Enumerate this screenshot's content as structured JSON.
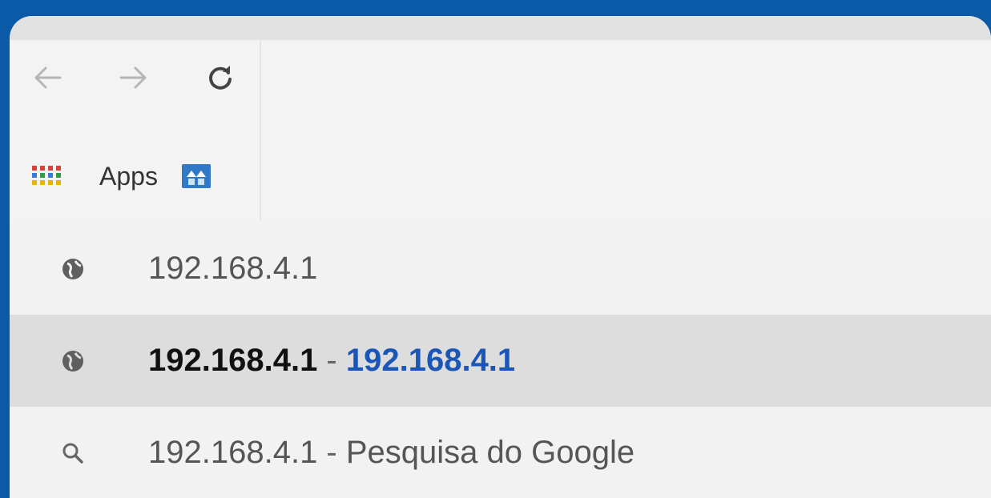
{
  "toolbar": {
    "back_icon": "arrow-left-icon",
    "forward_icon": "arrow-right-icon",
    "reload_icon": "reload-icon"
  },
  "bookmarks": {
    "apps_label": "Apps",
    "apps_icon": "apps-grid-icon",
    "site_icon": "bookmark-favicon"
  },
  "suggestions": [
    {
      "icon": "globe-icon",
      "text": "192.168.4.1"
    },
    {
      "icon": "globe-icon",
      "text": "192.168.4.1",
      "separator": " - ",
      "link": "192.168.4.1"
    },
    {
      "icon": "search-icon",
      "text": "192.168.4.1",
      "separator": " - ",
      "suffix": "Pesquisa do Google"
    }
  ],
  "colors": {
    "background": "#0a5aa8",
    "link": "#1a56b8",
    "selected_row": "#dddddd"
  }
}
